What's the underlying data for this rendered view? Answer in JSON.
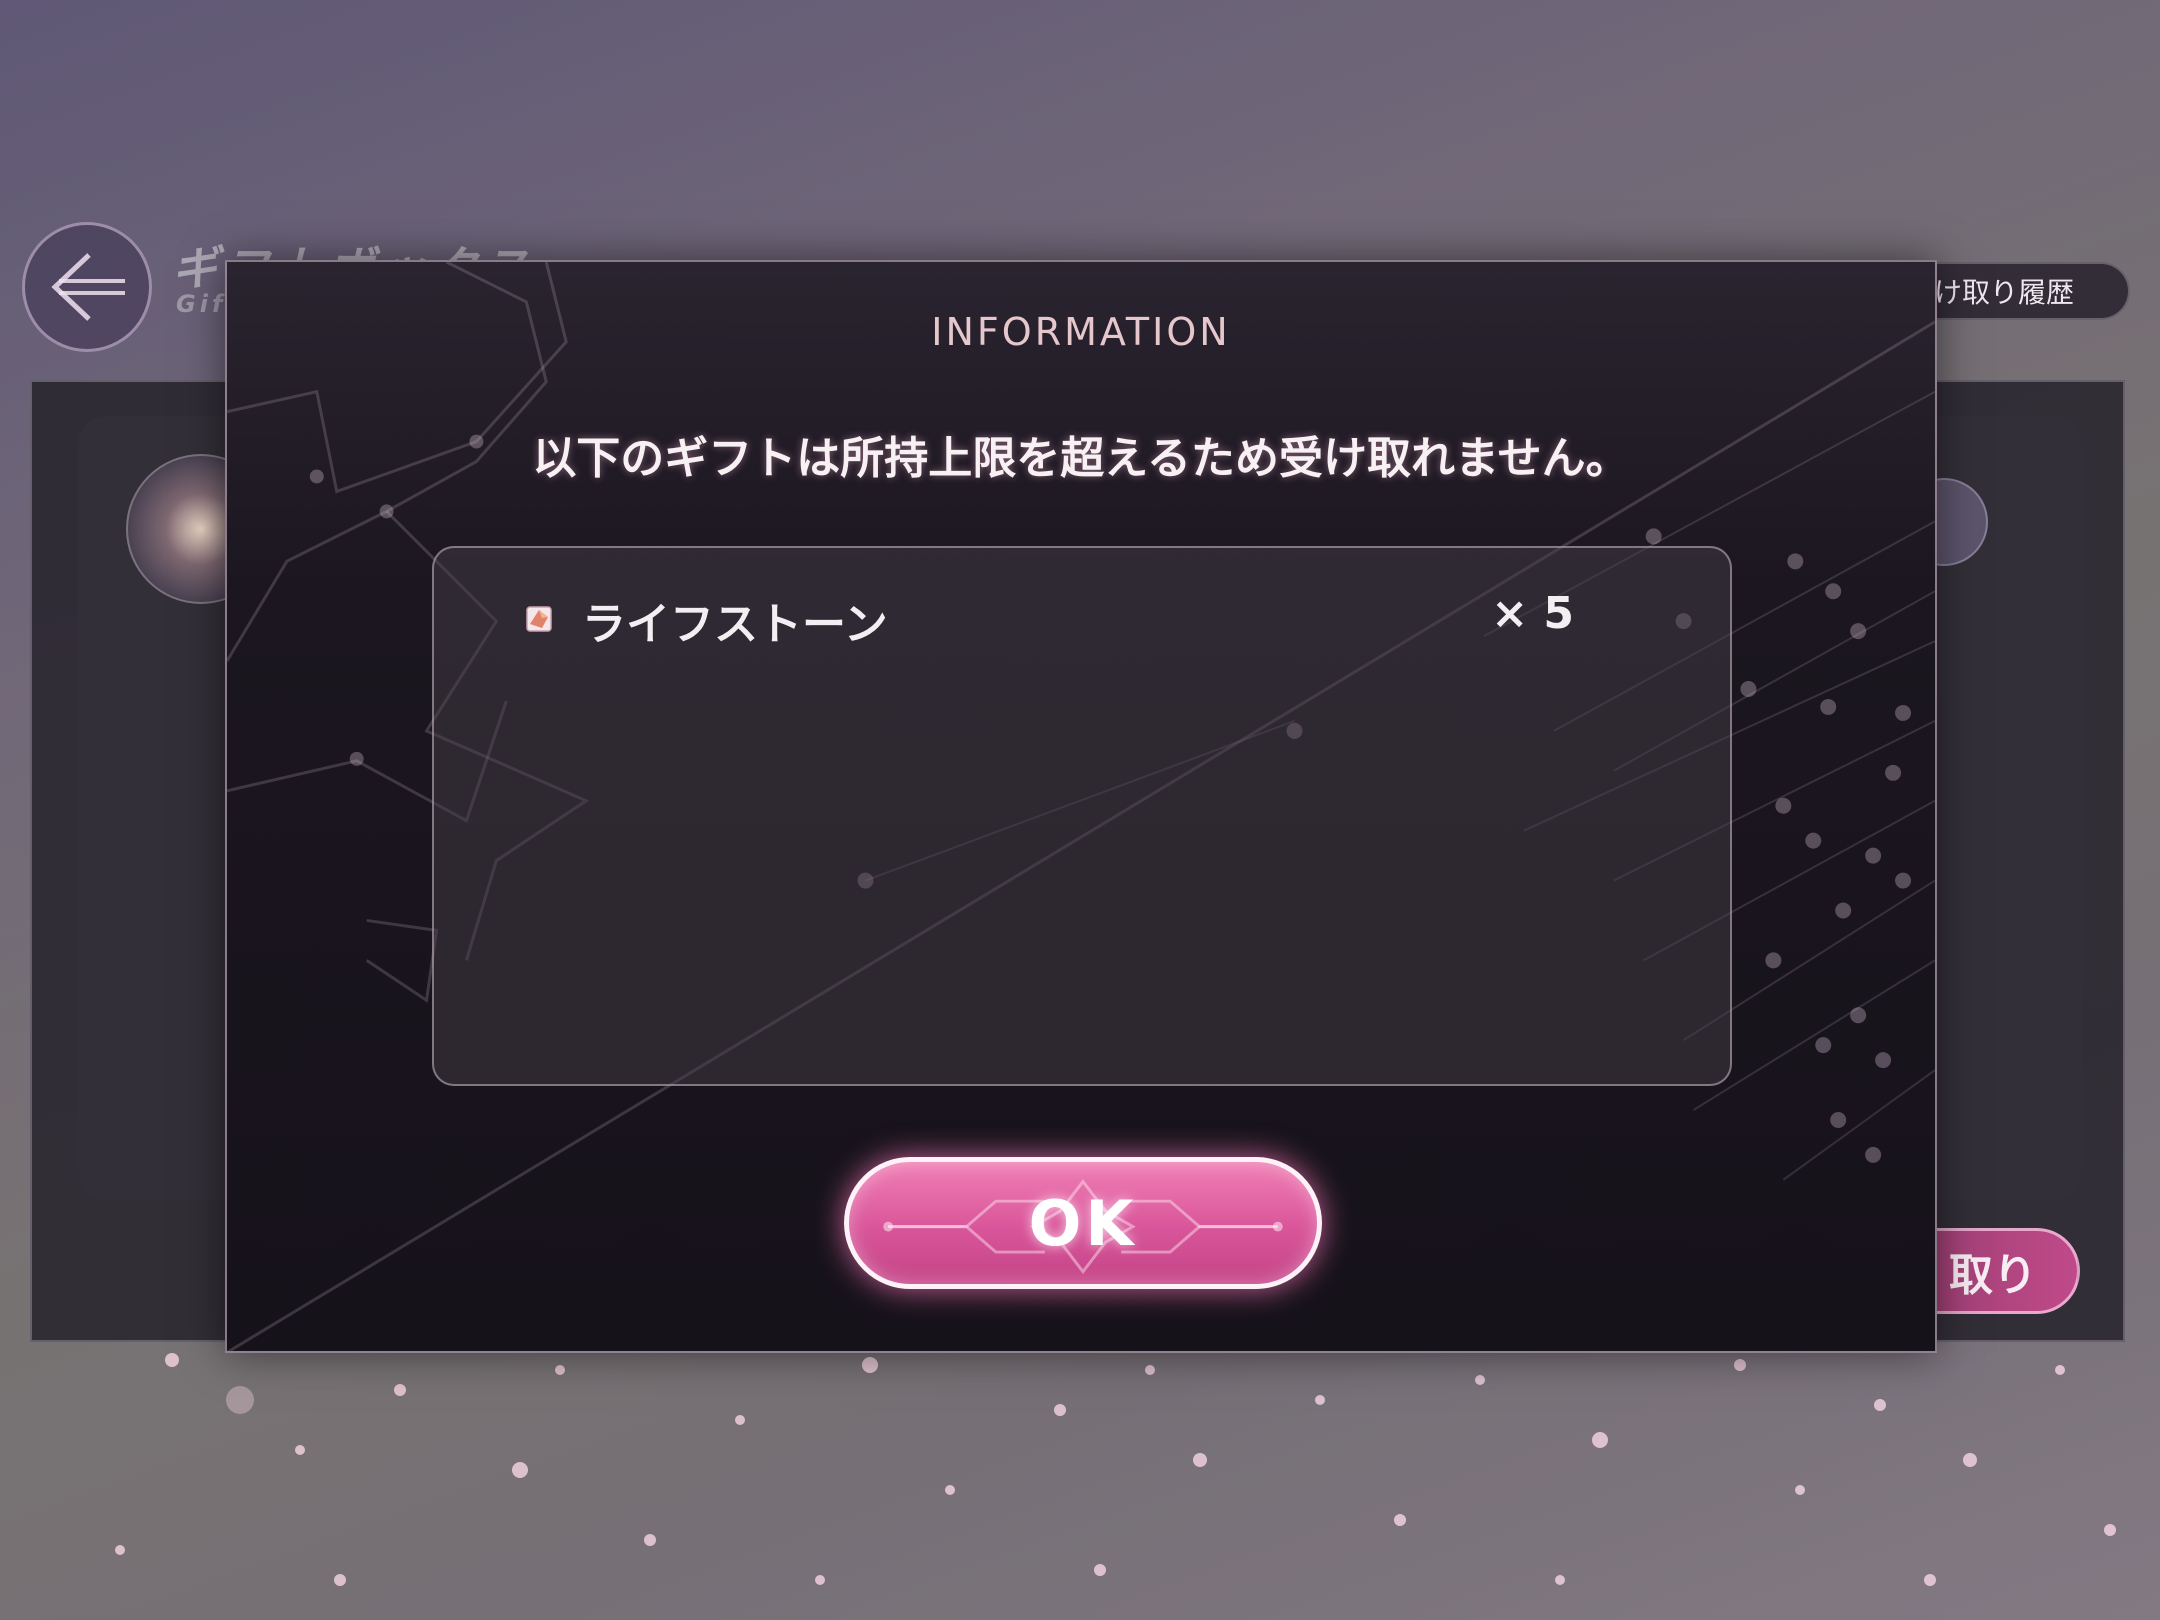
{
  "background": {
    "screen_title": "ギフトボックス",
    "screen_subtitle": "Gift",
    "history_button": "け取り履歴",
    "receive_button": "取り"
  },
  "modal": {
    "title": "INFORMATION",
    "message": "以下のギフトは所持上限を超えるため受け取れません。",
    "items": [
      {
        "icon": "life-stone-icon",
        "name": "ライフストーン",
        "quantity": "× 5"
      }
    ],
    "ok_label": "OK"
  },
  "colors": {
    "accent_pink": "#d9559a",
    "title_pink": "#e6c7cc",
    "modal_bg": "#1b161f"
  }
}
